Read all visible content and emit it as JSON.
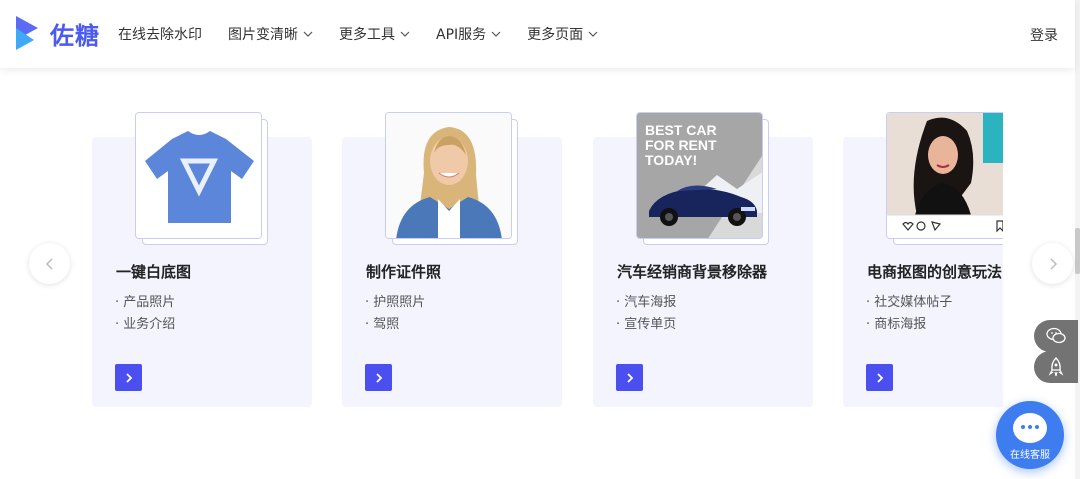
{
  "brand": {
    "name": "佐糖",
    "accent": "#4b5bf0"
  },
  "nav": [
    {
      "label": "在线去除水印",
      "has_dropdown": false
    },
    {
      "label": "图片变清晰",
      "has_dropdown": true
    },
    {
      "label": "更多工具",
      "has_dropdown": true
    },
    {
      "label": "API服务",
      "has_dropdown": true
    },
    {
      "label": "更多页面",
      "has_dropdown": true
    }
  ],
  "header": {
    "login_label": "登录"
  },
  "cards": [
    {
      "title": "一键白底图",
      "tags": [
        "· 产品照片",
        "· 业务介绍"
      ],
      "image": "blue-tshirt"
    },
    {
      "title": "制作证件照",
      "tags": [
        "· 护照照片",
        "· 驾照"
      ],
      "image": "woman-portrait"
    },
    {
      "title": "汽车经销商背景移除器",
      "tags": [
        "· 汽车海报",
        "· 宣传单页"
      ],
      "image": "car-rent-poster",
      "image_text": [
        "BEST CAR",
        "FOR RENT",
        "TODAY!"
      ]
    },
    {
      "title": "电商抠图的创意玩法",
      "tags": [
        "· 社交媒体帖子",
        "· 商标海报"
      ],
      "image": "social-post"
    }
  ],
  "floating": {
    "support_label": "在线客服"
  },
  "icons": {
    "prev": "chevron-left-icon",
    "next": "chevron-right-icon",
    "wechat": "wechat-icon",
    "rocket": "rocket-icon",
    "chat": "chat-icon"
  },
  "colors": {
    "card_bg": "#f3f4fd",
    "button": "#4b4ff0",
    "support": "#3d7df0",
    "side_button": "#737373"
  }
}
